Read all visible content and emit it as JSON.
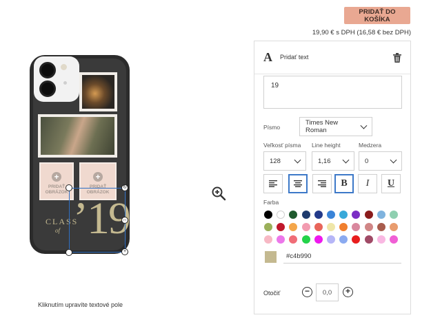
{
  "header": {
    "add_to_cart_label": "PRIDAŤ DO KOŠÍKA",
    "price_text": "19,90 € s DPH (16,58 € bez DPH)"
  },
  "preview": {
    "slots": [
      {
        "label": "PRIDAŤ OBRÁZOK"
      },
      {
        "label": "PRIDAŤ OBRÁZOK"
      }
    ],
    "design_text": {
      "class": "CLASS",
      "of": "of",
      "number": "’19"
    },
    "hint": "Kliknutím upravíte textové pole"
  },
  "panel": {
    "icon": "A",
    "title": "Pridať text",
    "text_value": "19",
    "font_label": "Písmo",
    "font_value": "Times New Roman",
    "size_label": "Veľkosť písma",
    "size_value": "128",
    "line_height_label": "Line height",
    "line_height_value": "1,16",
    "spacing_label": "Medzera",
    "spacing_value": "0",
    "format_buttons": [
      {
        "name": "align-left",
        "glyph": "≡",
        "active": false
      },
      {
        "name": "align-center",
        "glyph": "≡",
        "active": true
      },
      {
        "name": "align-right",
        "glyph": "≡",
        "active": false
      },
      {
        "name": "bold",
        "glyph": "B",
        "active": true
      },
      {
        "name": "italic",
        "glyph": "I",
        "active": false
      },
      {
        "name": "underline",
        "glyph": "U",
        "active": false
      }
    ],
    "color_label": "Farba",
    "palette": [
      [
        "#000000",
        "#ffffff",
        "#1f5a2e",
        "#1f3b6e",
        "#233a8a",
        "#3a84d8",
        "#38a9d9",
        "#7b2ec4",
        "#8a1c1c",
        "#7fb3de",
        "#8fcfb0"
      ],
      [
        "#9bb05a",
        "#c0182c",
        "#f4a64a",
        "#f29bb0",
        "#e8655a",
        "#efe6a8",
        "#f07f2e",
        "#d9889e",
        "#d08686",
        "#a85c4d",
        "#e89c6e"
      ],
      [
        "#f7b8c4",
        "#ec77ea",
        "#f06d77",
        "#23d34a",
        "#ee18ee",
        "#b6b6f7",
        "#8aaaf0",
        "#e81d1d",
        "#a04a66",
        "#f9b8e2",
        "#f05fd5"
      ]
    ],
    "current_color": "#c4b990",
    "current_color_hex": "#c4b990",
    "rotate_label": "Otočiť",
    "rotate_value": "0,0"
  }
}
